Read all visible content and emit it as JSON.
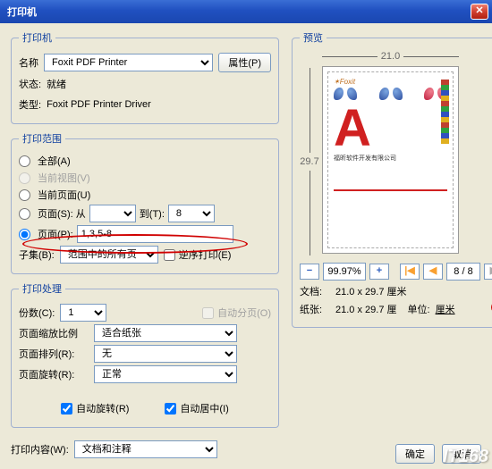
{
  "title": "打印机",
  "printer": {
    "name_label": "名称",
    "name_value": "Foxit PDF Printer",
    "properties_btn": "属性(P)",
    "status_label": "状态:",
    "status_value": "就绪",
    "type_label": "类型:",
    "type_value": "Foxit PDF Printer Driver"
  },
  "range": {
    "legend": "打印范围",
    "all": "全部(A)",
    "current_view": "当前视图(V)",
    "current_page": "当前页面(U)",
    "pages_s": "页面(S): 从",
    "to": "到(T):",
    "from_val": "",
    "to_val": "8",
    "pages_p": "页面(P):",
    "pages_p_val": "1,3,5-8",
    "subset": "子集(B):",
    "subset_val": "范围中的所有页",
    "reverse": "逆序打印(E)"
  },
  "handling": {
    "legend": "打印处理",
    "copies": "份数(C):",
    "copies_val": "1",
    "collate": "自动分页(O)",
    "scale": "页面缩放比例",
    "scale_val": "适合纸张",
    "arrange": "页面排列(R):",
    "arrange_val": "无",
    "rotate": "页面旋转(R):",
    "rotate_val": "正常",
    "auto_rotate": "自动旋转(R)",
    "auto_center": "自动居中(I)"
  },
  "print_what": {
    "label": "打印内容(W):",
    "value": "文档和注释"
  },
  "preview": {
    "legend": "预览",
    "width": "21.0",
    "height": "29.7",
    "company": "福昕软件开发有限公司",
    "zoom": "99.97%",
    "page_indicator": "8 / 8",
    "doc_label": "文档:",
    "doc_value": "21.0 x 29.7 厘米",
    "paper_label": "纸张:",
    "paper_value": "21.0 x 29.7 厘",
    "unit_label": "单位:",
    "unit_value": "厘米"
  },
  "buttons": {
    "ok": "确定",
    "cancel": "取消"
  },
  "watermark": "IT168"
}
